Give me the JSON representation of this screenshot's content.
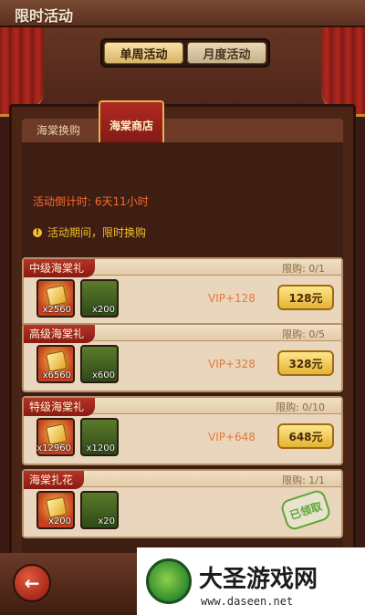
{
  "header": {
    "title": "限时活动"
  },
  "top_tabs": [
    {
      "label": "单周活动",
      "active": true
    },
    {
      "label": "月度活动",
      "active": false
    }
  ],
  "sub_tabs": [
    {
      "label": "海棠换购",
      "active": false
    },
    {
      "label": "海棠商店",
      "active": true
    }
  ],
  "countdown": "活动倒计时: 6天11小时",
  "notice": "活动期间，限时换购",
  "cards": [
    {
      "name": "中级海棠礼",
      "limit": "限购: 0/1",
      "items": [
        {
          "icon": "gold-ticket-icon",
          "count": "x2560"
        },
        {
          "icon": "green-item-icon",
          "count": "x200"
        }
      ],
      "vip": "VIP+128",
      "price": "128元",
      "claimed": false
    },
    {
      "name": "高级海棠礼",
      "limit": "限购: 0/5",
      "items": [
        {
          "icon": "gold-ticket-icon",
          "count": "x6560"
        },
        {
          "icon": "green-item-icon",
          "count": "x600"
        }
      ],
      "vip": "VIP+328",
      "price": "328元",
      "claimed": false
    },
    {
      "name": "特级海棠礼",
      "limit": "限购: 0/10",
      "items": [
        {
          "icon": "gold-ticket-icon",
          "count": "x12960"
        },
        {
          "icon": "green-item-icon",
          "count": "x1200"
        }
      ],
      "vip": "VIP+648",
      "price": "648元",
      "claimed": false
    },
    {
      "name": "海棠扎花",
      "limit": "限购: 1/1",
      "items": [
        {
          "icon": "gold-ticket-icon",
          "count": "x200"
        },
        {
          "icon": "green-item-icon",
          "count": "x20"
        }
      ],
      "vip": "",
      "price": "",
      "claimed": true,
      "claimed_label": "已领取"
    }
  ],
  "back_button": {
    "icon": "back-arrow-icon"
  },
  "watermark": {
    "title": "大圣游戏网",
    "url": "www.daseen.net"
  }
}
